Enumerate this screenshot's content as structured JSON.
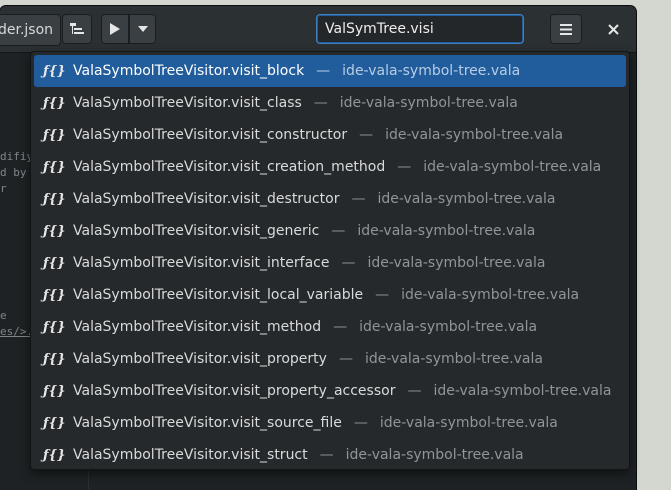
{
  "header": {
    "tab_fragment": "der.json",
    "run_icon": "play-icon",
    "run_menu_icon": "chevron-down-icon",
    "tree_icon": "tree-icon",
    "search_value": "ValSymTree.visi",
    "menu_icon": "hamburger-icon",
    "close_icon": "close-icon",
    "accent": "#215d9c"
  },
  "editor": {
    "fragments": [
      "difiy",
      "d by",
      "r",
      "e",
      "es/>."
    ]
  },
  "results": [
    {
      "icon": "ƒ{}",
      "name": "ValaSymbolTreeVisitor.visit_block",
      "sep": "—",
      "file": "ide-vala-symbol-tree.vala"
    },
    {
      "icon": "ƒ{}",
      "name": "ValaSymbolTreeVisitor.visit_class",
      "sep": "—",
      "file": "ide-vala-symbol-tree.vala"
    },
    {
      "icon": "ƒ{}",
      "name": "ValaSymbolTreeVisitor.visit_constructor",
      "sep": "—",
      "file": "ide-vala-symbol-tree.vala"
    },
    {
      "icon": "ƒ{}",
      "name": "ValaSymbolTreeVisitor.visit_creation_method",
      "sep": "—",
      "file": "ide-vala-symbol-tree.vala"
    },
    {
      "icon": "ƒ{}",
      "name": "ValaSymbolTreeVisitor.visit_destructor",
      "sep": "—",
      "file": "ide-vala-symbol-tree.vala"
    },
    {
      "icon": "ƒ{}",
      "name": "ValaSymbolTreeVisitor.visit_generic",
      "sep": "—",
      "file": "ide-vala-symbol-tree.vala"
    },
    {
      "icon": "ƒ{}",
      "name": "ValaSymbolTreeVisitor.visit_interface",
      "sep": "—",
      "file": "ide-vala-symbol-tree.vala"
    },
    {
      "icon": "ƒ{}",
      "name": "ValaSymbolTreeVisitor.visit_local_variable",
      "sep": "—",
      "file": "ide-vala-symbol-tree.vala"
    },
    {
      "icon": "ƒ{}",
      "name": "ValaSymbolTreeVisitor.visit_method",
      "sep": "—",
      "file": "ide-vala-symbol-tree.vala"
    },
    {
      "icon": "ƒ{}",
      "name": "ValaSymbolTreeVisitor.visit_property",
      "sep": "—",
      "file": "ide-vala-symbol-tree.vala"
    },
    {
      "icon": "ƒ{}",
      "name": "ValaSymbolTreeVisitor.visit_property_accessor",
      "sep": "—",
      "file": "ide-vala-symbol-tree.vala"
    },
    {
      "icon": "ƒ{}",
      "name": "ValaSymbolTreeVisitor.visit_source_file",
      "sep": "—",
      "file": "ide-vala-symbol-tree.vala"
    },
    {
      "icon": "ƒ{}",
      "name": "ValaSymbolTreeVisitor.visit_struct",
      "sep": "—",
      "file": "ide-vala-symbol-tree.vala"
    }
  ]
}
